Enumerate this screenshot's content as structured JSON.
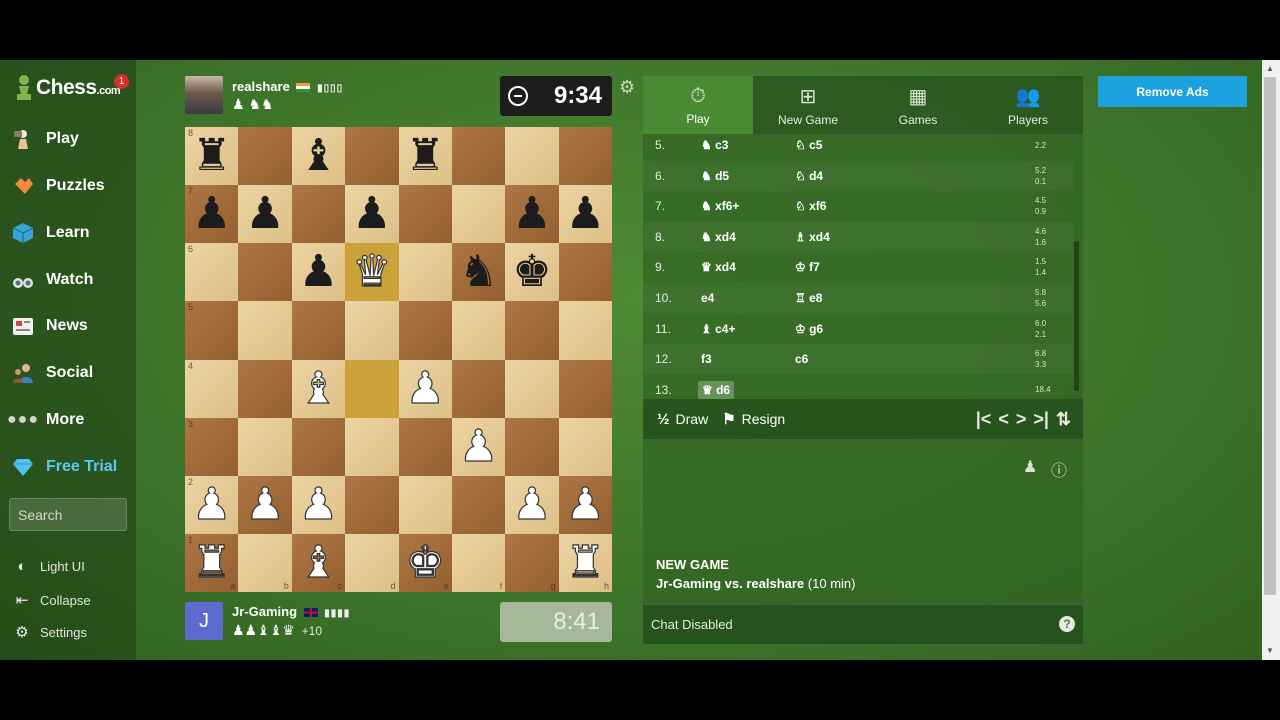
{
  "sidebar": {
    "logo_text": "Chess",
    "logo_suffix": ".com",
    "notification_count": "1",
    "nav": [
      {
        "label": "Play",
        "icon": "play-pawn-icon"
      },
      {
        "label": "Puzzles",
        "icon": "puzzle-icon"
      },
      {
        "label": "Learn",
        "icon": "learn-cube-icon"
      },
      {
        "label": "Watch",
        "icon": "binoculars-icon"
      },
      {
        "label": "News",
        "icon": "newspaper-icon"
      },
      {
        "label": "Social",
        "icon": "social-people-icon"
      },
      {
        "label": "More",
        "icon": "more-dots-icon"
      },
      {
        "label": "Free Trial",
        "icon": "diamond-icon"
      }
    ],
    "search_placeholder": "Search",
    "bottom": [
      {
        "label": "Light UI",
        "icon": "half-circle-icon"
      },
      {
        "label": "Collapse",
        "icon": "collapse-arrow-icon"
      },
      {
        "label": "Settings",
        "icon": "gear-icon"
      }
    ]
  },
  "top_player": {
    "name": "realshare",
    "clock": "9:34",
    "captured": "♟ ♞♞"
  },
  "bottom_player": {
    "name": "Jr-Gaming",
    "avatar_letter": "J",
    "clock": "8:41",
    "captured": "♟♟♝♝♛",
    "material": "+10"
  },
  "board": {
    "ranks": [
      "8",
      "7",
      "6",
      "5",
      "4",
      "3",
      "2",
      "1"
    ],
    "files": [
      "a",
      "b",
      "c",
      "d",
      "e",
      "f",
      "g",
      "h"
    ],
    "rows": [
      [
        "r",
        "",
        "b",
        "",
        "r",
        "",
        "",
        ""
      ],
      [
        "p",
        "p",
        "",
        "p",
        "",
        "",
        "p",
        "p"
      ],
      [
        "",
        "",
        "p",
        "Q",
        "",
        "n",
        "k",
        ""
      ],
      [
        "",
        "",
        "",
        "",
        "",
        "",
        "",
        ""
      ],
      [
        "",
        "",
        "B",
        "",
        "P",
        "",
        "",
        ""
      ],
      [
        "",
        "",
        "",
        "",
        "",
        "P",
        "",
        ""
      ],
      [
        "P",
        "P",
        "P",
        "",
        "",
        "",
        "P",
        "P"
      ],
      [
        "R",
        "",
        "B",
        "",
        "K",
        "",
        "",
        "R"
      ]
    ],
    "highlight": [
      "d6",
      "d4"
    ]
  },
  "tabs": [
    {
      "label": "Play",
      "icon": "stopwatch-icon"
    },
    {
      "label": "New Game",
      "icon": "plus-square-icon"
    },
    {
      "label": "Games",
      "icon": "chessboard-icon"
    },
    {
      "label": "Players",
      "icon": "players-icon"
    }
  ],
  "moves": [
    {
      "num": "5.",
      "white": "♞ c3",
      "black": "♘ c5",
      "tw": "2.2",
      "tb": ""
    },
    {
      "num": "6.",
      "white": "♞ d5",
      "black": "♘ d4",
      "tw": "5.2",
      "tb": "0.1"
    },
    {
      "num": "7.",
      "white": "♞ xf6+",
      "black": "♘ xf6",
      "tw": "4.5",
      "tb": "0.9"
    },
    {
      "num": "8.",
      "white": "♞ xd4",
      "black": "♗ xd4",
      "tw": "4.6",
      "tb": "1.6"
    },
    {
      "num": "9.",
      "white": "♛ xd4",
      "black": "♔ f7",
      "tw": "1.5",
      "tb": "1.4"
    },
    {
      "num": "10.",
      "white": "e4",
      "black": "♖ e8",
      "tw": "5.8",
      "tb": "5.6"
    },
    {
      "num": "11.",
      "white": "♝ c4+",
      "black": "♔ g6",
      "tw": "6.0",
      "tb": "2.1"
    },
    {
      "num": "12.",
      "white": "f3",
      "black": "c6",
      "tw": "6.8",
      "tb": "3.3"
    },
    {
      "num": "13.",
      "white": "♛ d6",
      "black": "",
      "tw": "18.4",
      "tb": ""
    }
  ],
  "actions": {
    "draw": "Draw",
    "draw_icon_text": "½",
    "resign": "Resign"
  },
  "new_game": {
    "title": "NEW GAME",
    "white": "Jr-Gaming",
    "vs": "vs.",
    "black": "realshare",
    "time": "(10 min)"
  },
  "chat": {
    "status": "Chat Disabled",
    "help": "?"
  },
  "remove_ads": "Remove Ads"
}
